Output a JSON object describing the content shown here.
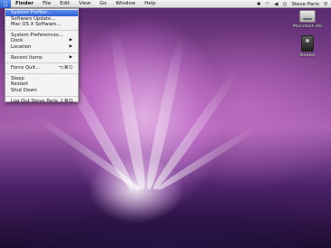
{
  "menubar": {
    "apple_icon": "apple-logo",
    "items": [
      {
        "label": "Finder",
        "bold": true
      },
      {
        "label": "File"
      },
      {
        "label": "Edit"
      },
      {
        "label": "View"
      },
      {
        "label": "Go"
      },
      {
        "label": "Window"
      },
      {
        "label": "Help"
      }
    ],
    "user_name": "Steve Paris",
    "status_icons": [
      "bluetooth-icon",
      "wifi-icon",
      "volume-icon",
      "clock-icon",
      "spotlight-icon"
    ]
  },
  "apple_menu": {
    "items": [
      {
        "label": "System Profiler...",
        "selected": true
      },
      {
        "label": "Software Update..."
      },
      {
        "label": "Mac OS X Software..."
      },
      {
        "separator": true
      },
      {
        "label": "System Preferences..."
      },
      {
        "label": "Dock",
        "submenu": true
      },
      {
        "label": "Location",
        "submenu": true
      },
      {
        "separator": true
      },
      {
        "label": "Recent Items",
        "submenu": true
      },
      {
        "separator": true
      },
      {
        "label": "Force Quit...",
        "shortcut": "⌥⌘⎋"
      },
      {
        "separator": true
      },
      {
        "label": "Sleep"
      },
      {
        "label": "Restart"
      },
      {
        "label": "Shut Down"
      },
      {
        "separator": true
      },
      {
        "label": "Log Out Steve Paris",
        "shortcut": "⇧⌘Q"
      }
    ]
  },
  "desktop_icons": [
    {
      "label": "Macintosh HD",
      "icon": "hard-drive-icon"
    },
    {
      "label": "Steeker",
      "icon": "external-drive-icon"
    }
  ],
  "colors": {
    "selection": "#3a6ad9",
    "menubar": "#e6e6e6",
    "wallpaper_main": "#a762b0"
  }
}
